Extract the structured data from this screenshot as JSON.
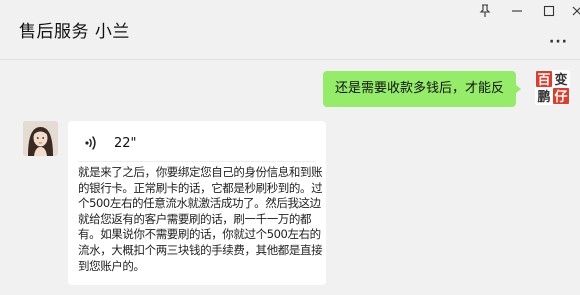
{
  "window": {
    "title": "售后服务 小兰",
    "more_label": "···",
    "controls": [
      "pin-icon",
      "minimize-icon",
      "maximize-icon",
      "close-icon"
    ]
  },
  "messages": {
    "outgoing": {
      "text": "还是需要收款多钱后，才能反"
    },
    "incoming_voice": {
      "duration": "22\"",
      "transcript": "就是来了之后，你要绑定您自己的身份信息和到账的银行卡。正常刷卡的话，它都是秒刷秒到的。过个500左右的任意流水就激活成功了。然后我这边就给您返有的客户需要刷的话，刷一千一万的都有。如果说你不需要刷的话，你就过个500左右的流水，大概扣个两三块钱的手续费，其他都是直接到您账户的。"
    }
  },
  "avatar_me": {
    "chars": [
      "百",
      "变",
      "鹏",
      "仔"
    ],
    "colors": {
      "red": "#e23b2a",
      "dark": "#333333"
    }
  },
  "colors": {
    "bubble_out": "#95ec69",
    "background": "#f1f1f1",
    "card": "#ffffff"
  }
}
